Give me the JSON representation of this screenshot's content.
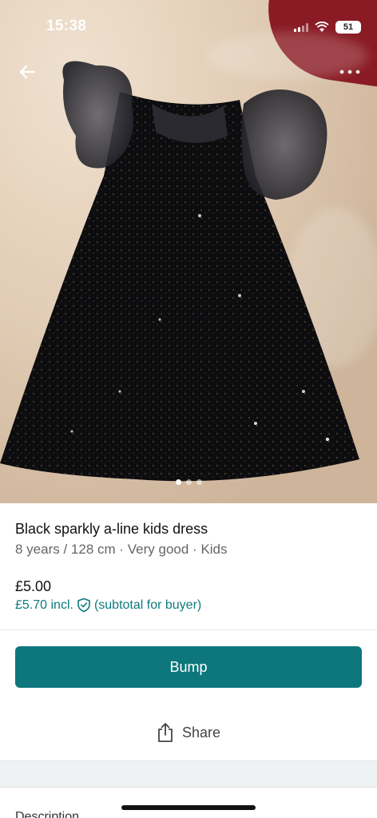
{
  "status_bar": {
    "time": "15:38",
    "battery": "51"
  },
  "item": {
    "title": "Black sparkly a-line kids dress",
    "meta": "8 years / 128 cm · Very good · Kids",
    "price": "£5.00",
    "price_incl": "£5.70 incl.",
    "price_note": "(subtotal for buyer)"
  },
  "gallery": {
    "photo_count": 3,
    "active_index": 0
  },
  "actions": {
    "bump_label": "Bump",
    "share_label": "Share"
  },
  "section": {
    "description_label": "Description"
  },
  "colors": {
    "accent": "#0d777d",
    "link": "#0e7a7e"
  }
}
